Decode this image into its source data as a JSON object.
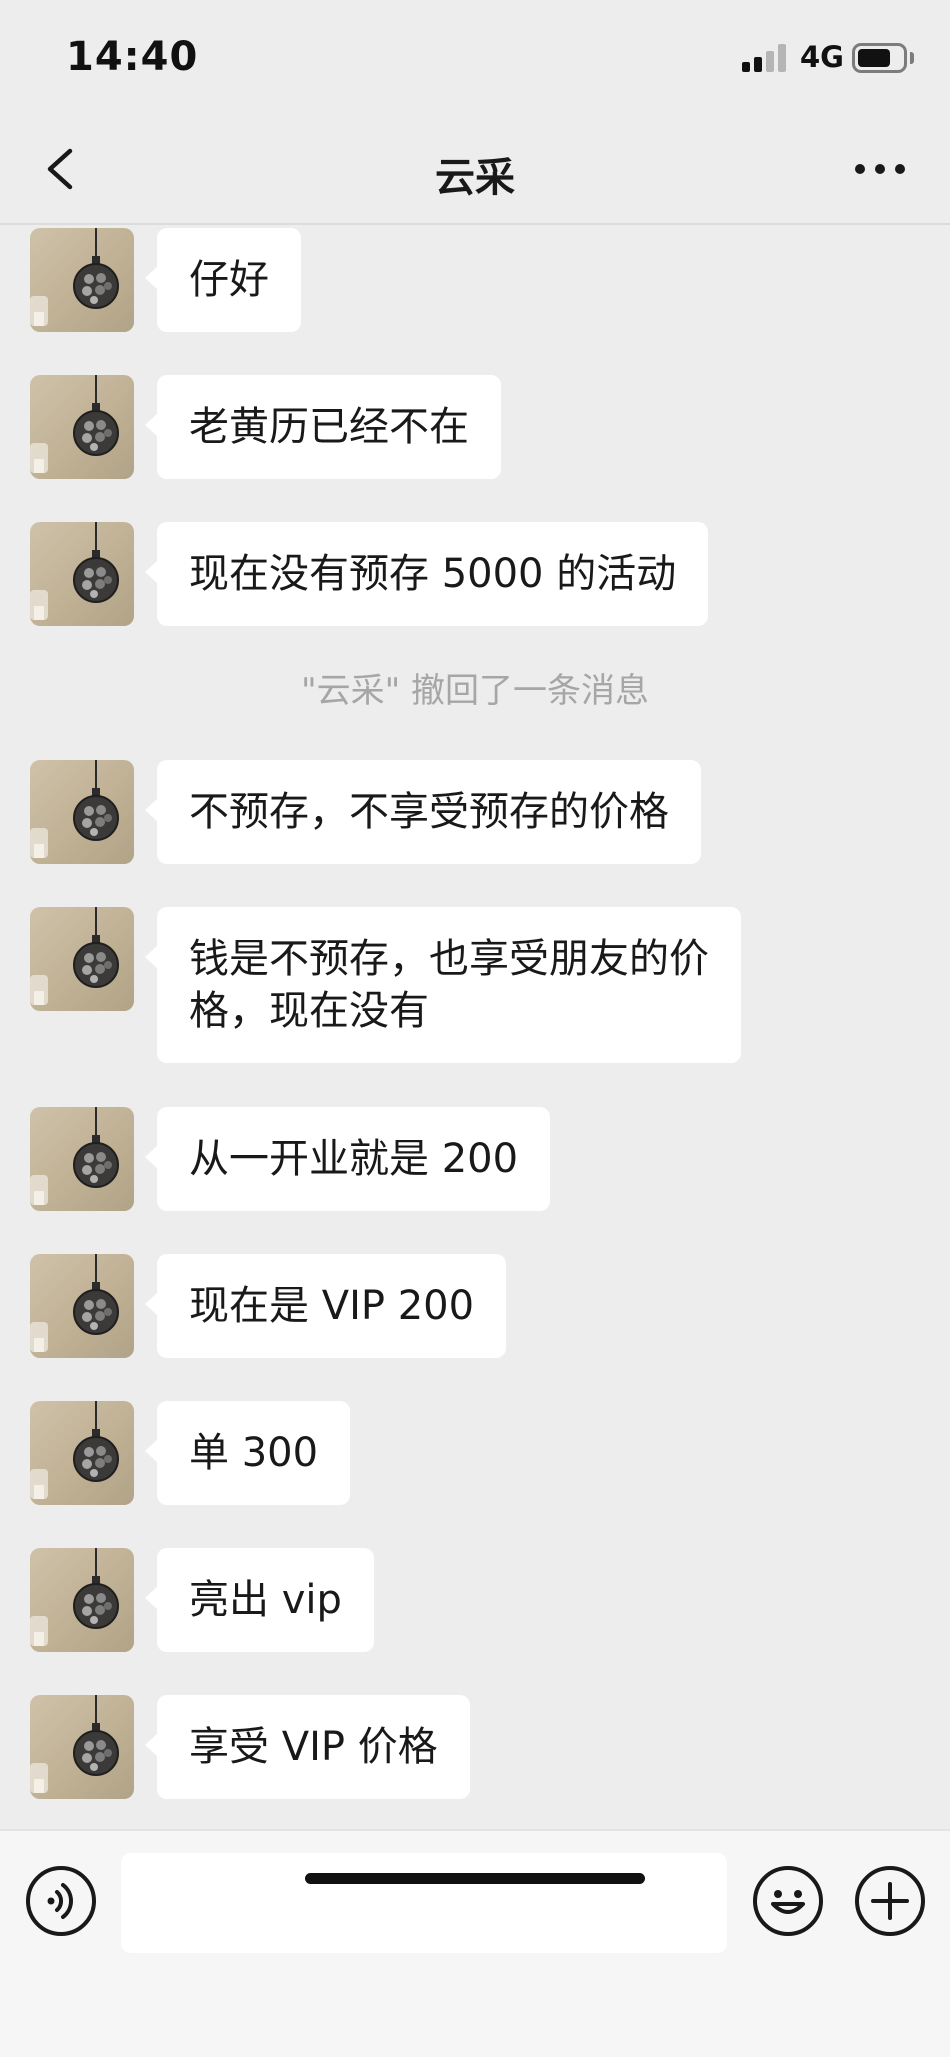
{
  "status_bar": {
    "time": "14:40",
    "network": "4G"
  },
  "nav": {
    "title": "云采",
    "back_icon": "chevron-left-icon",
    "more_icon": "more-dots-icon"
  },
  "messages": [
    {
      "type": "incoming",
      "text": "仔好"
    },
    {
      "type": "incoming",
      "text": "老黄历已经不在"
    },
    {
      "type": "incoming",
      "text": "现在没有预存 5000 的活动"
    },
    {
      "type": "system",
      "text": "\"云采\" 撤回了一条消息"
    },
    {
      "type": "incoming",
      "text": "不预存，不享受预存的价格"
    },
    {
      "type": "incoming",
      "text": "钱是不预存，也享受朋友的价\n格，现在没有"
    },
    {
      "type": "incoming",
      "text": "从一开业就是 200"
    },
    {
      "type": "incoming",
      "text": "现在是 VIP 200"
    },
    {
      "type": "incoming",
      "text": "单 300"
    },
    {
      "type": "incoming",
      "text": "亮出 vip"
    },
    {
      "type": "incoming",
      "text": "享受 VIP 价格"
    }
  ],
  "input_bar": {
    "voice_icon": "voice-icon",
    "message_value": "",
    "emoji_icon": "emoji-icon",
    "plus_icon": "plus-icon"
  },
  "colors": {
    "background": "#ededed",
    "bubble": "#ffffff",
    "system_text": "#a6a6a6",
    "input_bar": "#f6f6f6"
  }
}
